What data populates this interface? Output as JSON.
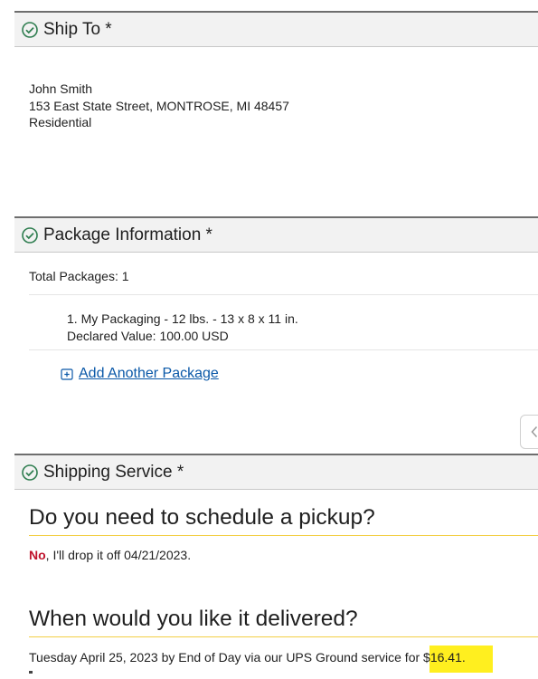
{
  "ship_to": {
    "title": "Ship To *",
    "name": "John Smith",
    "street": "153 East State Street, MONTROSE, MI 48457",
    "type": "Residential"
  },
  "package_info": {
    "title": "Package Information *",
    "total": "Total Packages: 1",
    "item_line1": "1. My Packaging - 12 lbs. - 13 x 8 x 11 in.",
    "item_line2": "Declared Value: 100.00 USD",
    "add_link": "Add Another Package"
  },
  "shipping_service": {
    "title": "Shipping Service *",
    "pickup_question": "Do you need to schedule a pickup?",
    "pickup_no": "No",
    "pickup_rest": ", I'll drop it off 04/21/2023.",
    "delivery_question": "When would you like it delivered?",
    "delivery_prefix": "Tuesday April 25, 2023 by End of Day via our UPS Ground service for ",
    "delivery_price": "$16.41",
    "delivery_suffix": "."
  },
  "colors": {
    "accent_green": "#2e7d4f",
    "link_blue": "#0a58a8",
    "rule_yellow": "#f3cf45",
    "highlight_yellow": "#ffef1f",
    "no_red": "#c0132c"
  },
  "icons": {
    "section_check": "check-circle-icon",
    "add_package": "plus-box-icon",
    "side_tab": "chevron-left-icon"
  }
}
